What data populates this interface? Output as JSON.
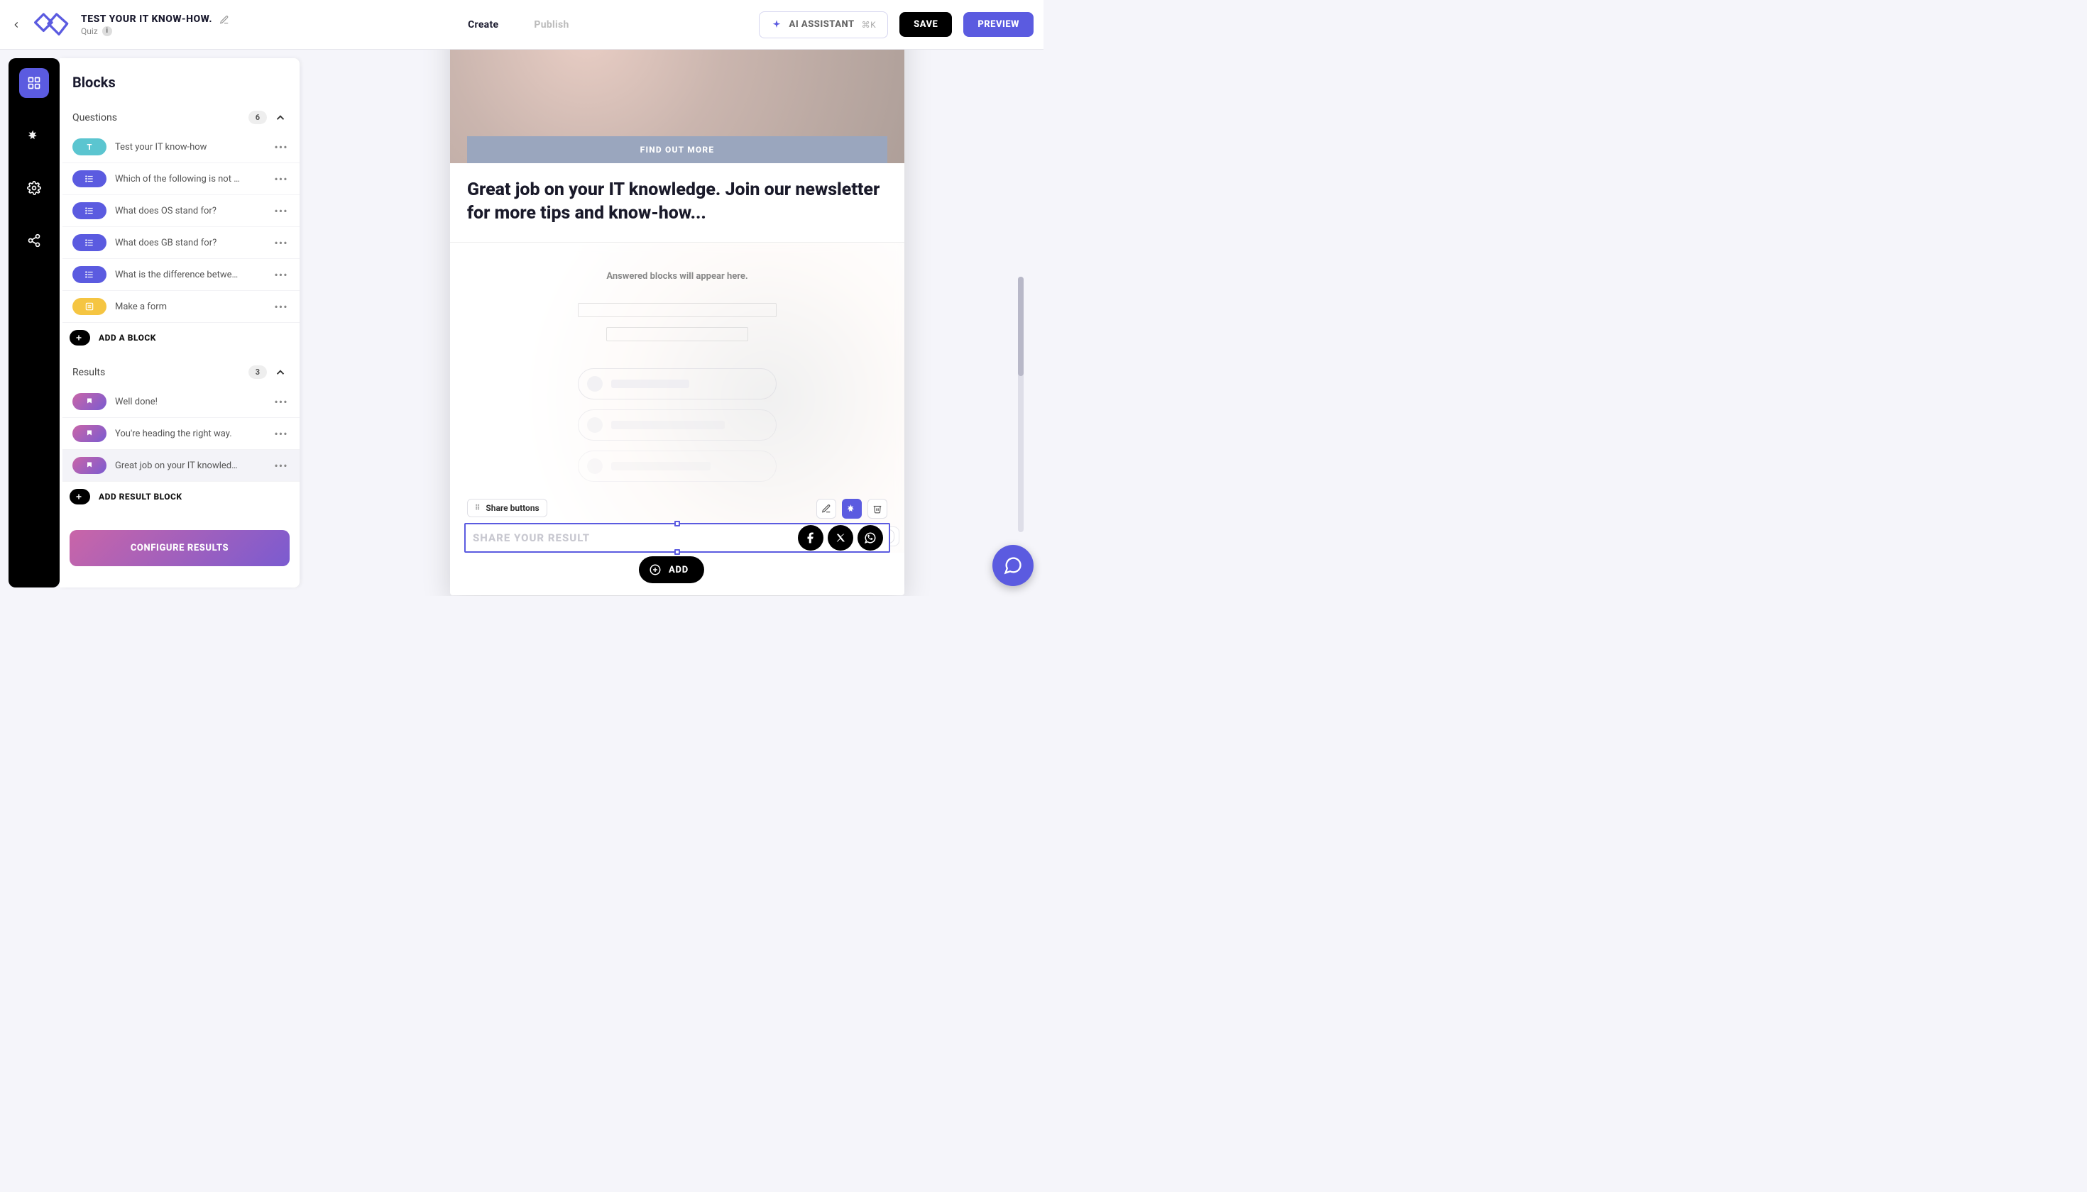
{
  "header": {
    "title": "TEST YOUR IT KNOW-HOW.",
    "subtitle": "Quiz",
    "nav": {
      "create": "Create",
      "publish": "Publish"
    },
    "ai": {
      "label": "AI ASSISTANT",
      "shortcut": "⌘K"
    },
    "save": "SAVE",
    "preview": "PREVIEW"
  },
  "sidebar": {
    "title": "Blocks",
    "questions": {
      "label": "Questions",
      "count": "6",
      "items": [
        {
          "icon_letter": "T",
          "label": "Test your IT know-how"
        },
        {
          "label": "Which of the following is not …"
        },
        {
          "label": "What does OS stand for?"
        },
        {
          "label": "What does GB stand for?"
        },
        {
          "label": "What is the difference betwe…"
        },
        {
          "label": "Make a form"
        }
      ],
      "add": "ADD A BLOCK"
    },
    "results": {
      "label": "Results",
      "count": "3",
      "items": [
        {
          "label": "Well done!"
        },
        {
          "label": "You're heading the right way."
        },
        {
          "label": "Great job on your IT knowled…"
        }
      ],
      "add": "ADD RESULT BLOCK"
    },
    "configure": "CONFIGURE RESULTS"
  },
  "canvas": {
    "find_out": "FIND OUT MORE",
    "headline": "Great job on your IT knowledge. Join our newsletter for more tips and know-how...",
    "answered_placeholder": "Answered blocks will appear here.",
    "share_toolbar": "Share buttons",
    "share_placeholder": "SHARE YOUR RESULT",
    "add": "ADD"
  }
}
